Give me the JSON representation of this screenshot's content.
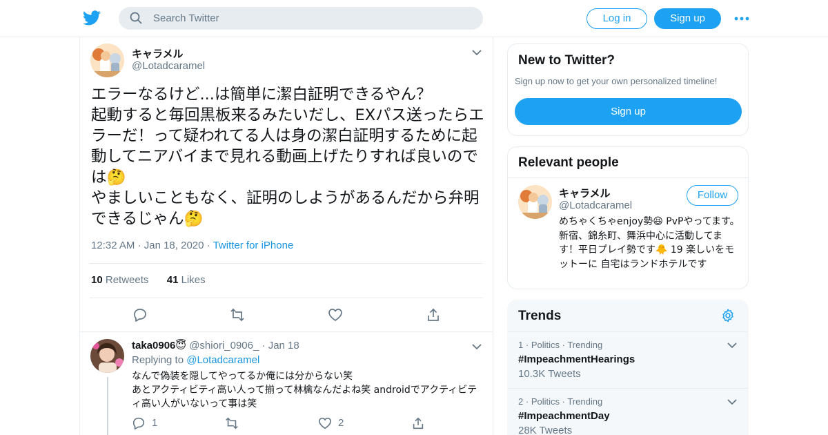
{
  "colors": {
    "brand": "#1da1f2",
    "link": "#1b95e0",
    "secondary_text": "#657786",
    "border": "#e6ecf0"
  },
  "header": {
    "logo_icon": "twitter-bird-icon",
    "search": {
      "placeholder": "Search Twitter",
      "value": ""
    },
    "login_label": "Log in",
    "signup_label": "Sign up",
    "more_icon": "more-dots-icon"
  },
  "tweet": {
    "author_name": "キャラメル",
    "author_handle": "@Lotadcaramel",
    "text": "エラーなるけど...は簡単に潔白証明できるやん？\n起動すると毎回黒板来るみたいだし、EXパス送ったらエラーだ！って疑われてる人は身の潔白証明するために起動してニアバイまで見れる動画上げたりすれば良いのでは🤔\nやましいこともなく、証明のしようがあるんだから弁明できるじゃん🤔",
    "time": "12:32 AM",
    "date": "Jan 18, 2020",
    "source": "Twitter for iPhone",
    "retweets_count": "10",
    "retweets_label": "Retweets",
    "likes_count": "41",
    "likes_label": "Likes"
  },
  "reply": {
    "author_name": "taka0906😇",
    "author_handle": "@shiori_0906_",
    "date": "Jan 18",
    "replying_prefix": "Replying to",
    "replying_to": "@Lotadcaramel",
    "text": "なんで偽装を隠してやってるか俺には分からない笑\nあとアクティビティ高い人って揃って林檎なんだよね笑 androidでアクティビティ高い人がいないって事は笑",
    "reply_count": "1",
    "like_count": "2"
  },
  "sidebar": {
    "new_to_twitter": {
      "title": "New to Twitter?",
      "subtitle": "Sign up now to get your own personalized timeline!",
      "signup_label": "Sign up"
    },
    "relevant_people": {
      "title": "Relevant people",
      "person": {
        "name": "キャラメル",
        "handle": "@Lotadcaramel",
        "follow_label": "Follow",
        "bio": "めちゃくちゃenjoy勢😆 PvPやってます。新宿、錦糸町、舞浜中心に活動してます！平日プレイ勢です🐥 19 楽しいをモットーに 自宅はランドホテルです"
      }
    },
    "trends": {
      "title": "Trends",
      "items": [
        {
          "rank": "1",
          "category": "Politics",
          "status": "Trending",
          "name": "#ImpeachmentHearings",
          "count": "10.3K Tweets"
        },
        {
          "rank": "2",
          "category": "Politics",
          "status": "Trending",
          "name": "#ImpeachmentDay",
          "count": "28K Tweets"
        }
      ]
    }
  }
}
